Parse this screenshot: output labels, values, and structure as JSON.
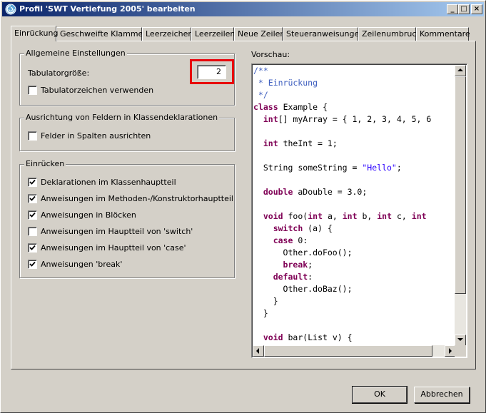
{
  "window": {
    "title": "Profil 'SWT Vertiefung 2005' bearbeiten",
    "minimize": "_",
    "maximize": "□",
    "close": "×"
  },
  "tabs": [
    {
      "label": "Einrückung",
      "active": true
    },
    {
      "label": "Geschweifte Klammern"
    },
    {
      "label": "Leerzeichen"
    },
    {
      "label": "Leerzeilen"
    },
    {
      "label": "Neue Zeilen"
    },
    {
      "label": "Steueranweisungen"
    },
    {
      "label": "Zeilenumbruch"
    },
    {
      "label": "Kommentare"
    }
  ],
  "general": {
    "title": "Allgemeine Einstellungen",
    "tab_size_label": "Tabulatorgröße:",
    "tab_size_value": "2",
    "use_tab_label": "Tabulatorzeichen verwenden",
    "use_tab_checked": false
  },
  "alignment": {
    "title": "Ausrichtung von Feldern in Klassendeklarationen",
    "align_label": "Felder in Spalten ausrichten",
    "align_checked": false
  },
  "indent": {
    "title": "Einrücken",
    "items": [
      {
        "label": "Deklarationen im Klassenhauptteil",
        "checked": true
      },
      {
        "label": "Anweisungen im Methoden-/Konstruktorhauptteil",
        "checked": true
      },
      {
        "label": "Anweisungen in Blöcken",
        "checked": true
      },
      {
        "label": "Anweisungen im Hauptteil von 'switch'",
        "checked": false
      },
      {
        "label": "Anweisungen im Hauptteil von 'case'",
        "checked": true
      },
      {
        "label": "Anweisungen 'break'",
        "checked": true
      }
    ]
  },
  "preview": {
    "label": "Vorschau:",
    "lines": [
      "/**",
      " * Einrückung",
      " */",
      "class Example {",
      "  int[] myArray = { 1, 2, 3, 4, 5, 6",
      "",
      "  int theInt = 1;",
      "",
      "  String someString = \"Hello\";",
      "",
      "  double aDouble = 3.0;",
      "",
      "  void foo(int a, int b, int c, int",
      "    switch (a) {",
      "    case 0:",
      "      Other.doFoo();",
      "      break;",
      "    default:",
      "      Other.doBaz();",
      "    }",
      "  }",
      "",
      "  void bar(List v) {"
    ]
  },
  "buttons": {
    "ok": "OK",
    "cancel": "Abbrechen"
  },
  "colors": {
    "highlight": "#e8000a",
    "keyword": "#7f0055",
    "comment": "#3f5fbf",
    "string": "#2a00ff"
  }
}
